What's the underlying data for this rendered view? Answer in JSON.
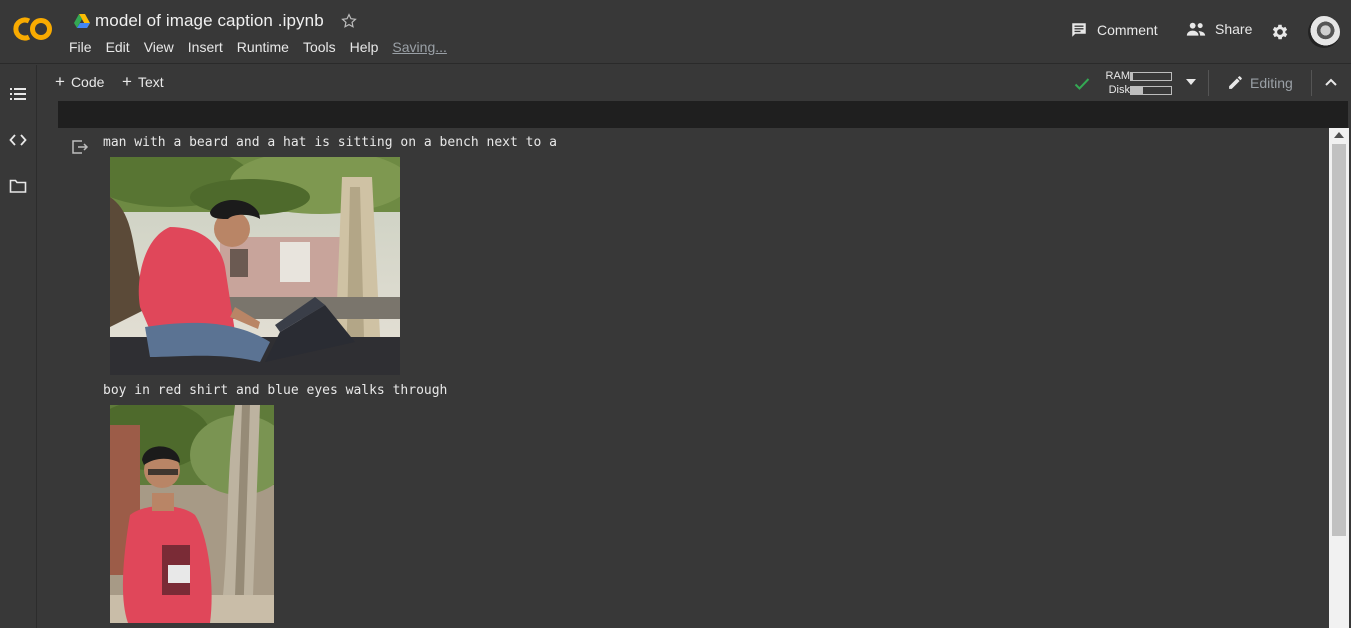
{
  "header": {
    "doc_title": "model of image caption .ipynb",
    "menu": [
      "File",
      "Edit",
      "View",
      "Insert",
      "Runtime",
      "Tools",
      "Help"
    ],
    "saving": "Saving...",
    "comment_label": "Comment",
    "share_label": "Share"
  },
  "toolbar": {
    "code_label": "Code",
    "text_label": "Text",
    "ram_label": "RAM",
    "disk_label": "Disk",
    "ram_usage": 0.05,
    "disk_usage": 0.3,
    "editing_label": "Editing"
  },
  "output": {
    "items": [
      {
        "caption": "man with a beard and a hat is sitting on a bench next to a"
      },
      {
        "caption": "boy in red shirt and blue eyes walks through"
      }
    ]
  },
  "colors": {
    "background": "#383838",
    "logo_orange": "#f9ab00",
    "check_green": "#34a853",
    "sweater_red": "#e0475a"
  },
  "icons": [
    "colab-logo-icon",
    "drive-icon",
    "star-icon",
    "comment-icon",
    "share-people-icon",
    "gear-icon",
    "toc-icon",
    "code-snippets-icon",
    "folder-icon",
    "check-icon",
    "caret-down-icon",
    "pencil-icon",
    "chevron-up-icon",
    "output-icon"
  ]
}
